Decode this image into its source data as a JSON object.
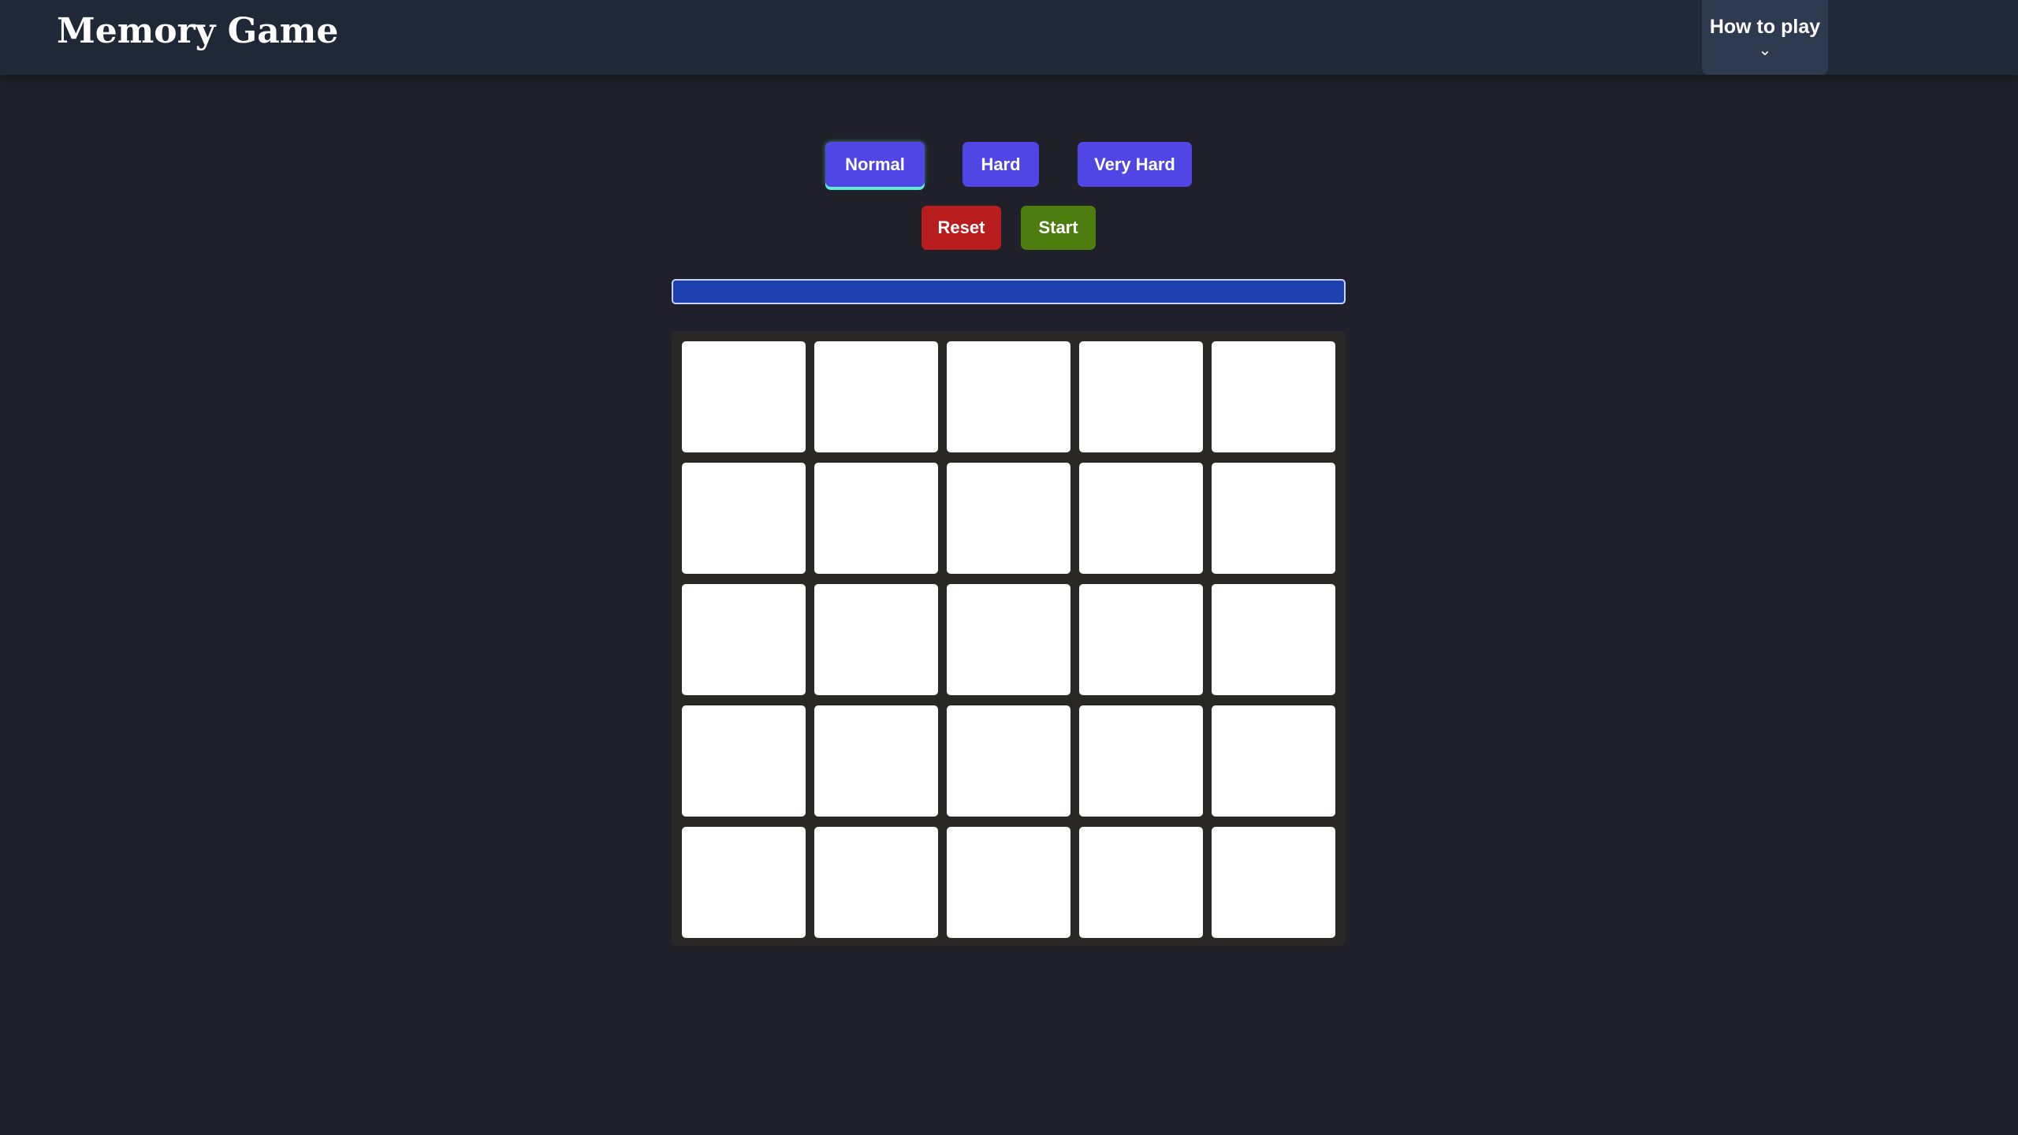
{
  "header": {
    "title": "Memory Game",
    "how_to_play": "How to play",
    "chevron_icon": "chevron-down-icon"
  },
  "difficulty": [
    {
      "label": "Normal",
      "selected": true
    },
    {
      "label": "Hard",
      "selected": false
    },
    {
      "label": "Very Hard",
      "selected": false
    }
  ],
  "controls": {
    "reset": "Reset",
    "start": "Start"
  },
  "progress": {
    "percent": 100,
    "color": "#1e40af"
  },
  "board": {
    "rows": 5,
    "cols": 5,
    "cards_face_down": 25
  }
}
